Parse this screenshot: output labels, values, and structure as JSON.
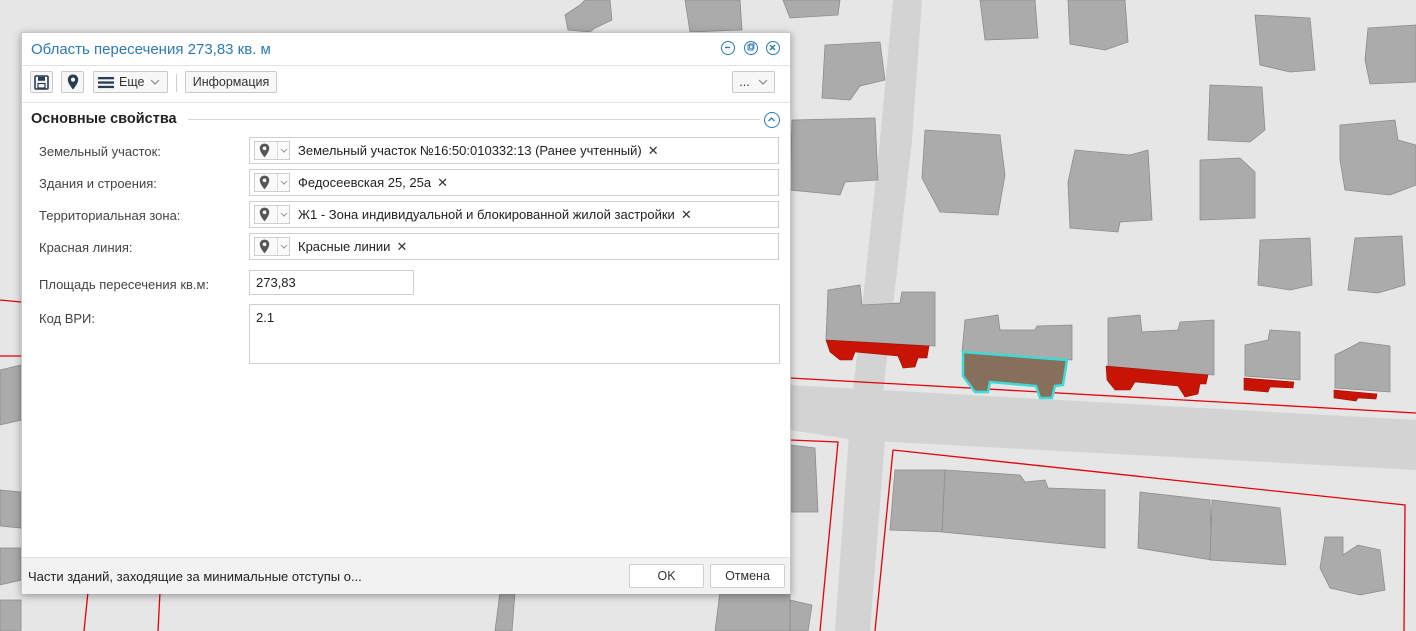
{
  "dialog": {
    "title": "Область пересечения 273,83 кв. м",
    "window_buttons": [
      "minimize-icon",
      "restore-icon",
      "close-icon"
    ]
  },
  "toolbar": {
    "save_icon": "save-icon",
    "location_icon": "map-pin-icon",
    "more_label": "Еще",
    "info_label": "Информация",
    "overflow_label": "..."
  },
  "section": {
    "title": "Основные свойства"
  },
  "fields": {
    "land_plot": {
      "label": "Земельный участок:",
      "value": "Земельный участок №16:50:010332:13 (Ранее учтенный)"
    },
    "buildings": {
      "label": "Здания и строения:",
      "value": "Федосеевская 25, 25а"
    },
    "zone": {
      "label": "Территориальная зона:",
      "value": "Ж1 - Зона индивидуальной и блокированной жилой застройки"
    },
    "red_line": {
      "label": "Красная линия:",
      "value": "Красные линии"
    },
    "area": {
      "label": "Площадь пересечения кв.м:",
      "value": "273,83"
    },
    "vri_code": {
      "label": "Код ВРИ:",
      "value": "2.1"
    }
  },
  "footer": {
    "status_text": "Части зданий, заходящие за минимальные отступы о...",
    "ok_label": "OK",
    "cancel_label": "Отмена"
  },
  "colors": {
    "accent": "#2a7ab8",
    "building": "#ababab",
    "red_line": "#e8000b",
    "encroachment": "#c81405",
    "selected_fill": "#86705c",
    "selected_outline": "#3fd9d6",
    "map_bg": "#e6e6e6",
    "road": "#d2d2d2"
  }
}
